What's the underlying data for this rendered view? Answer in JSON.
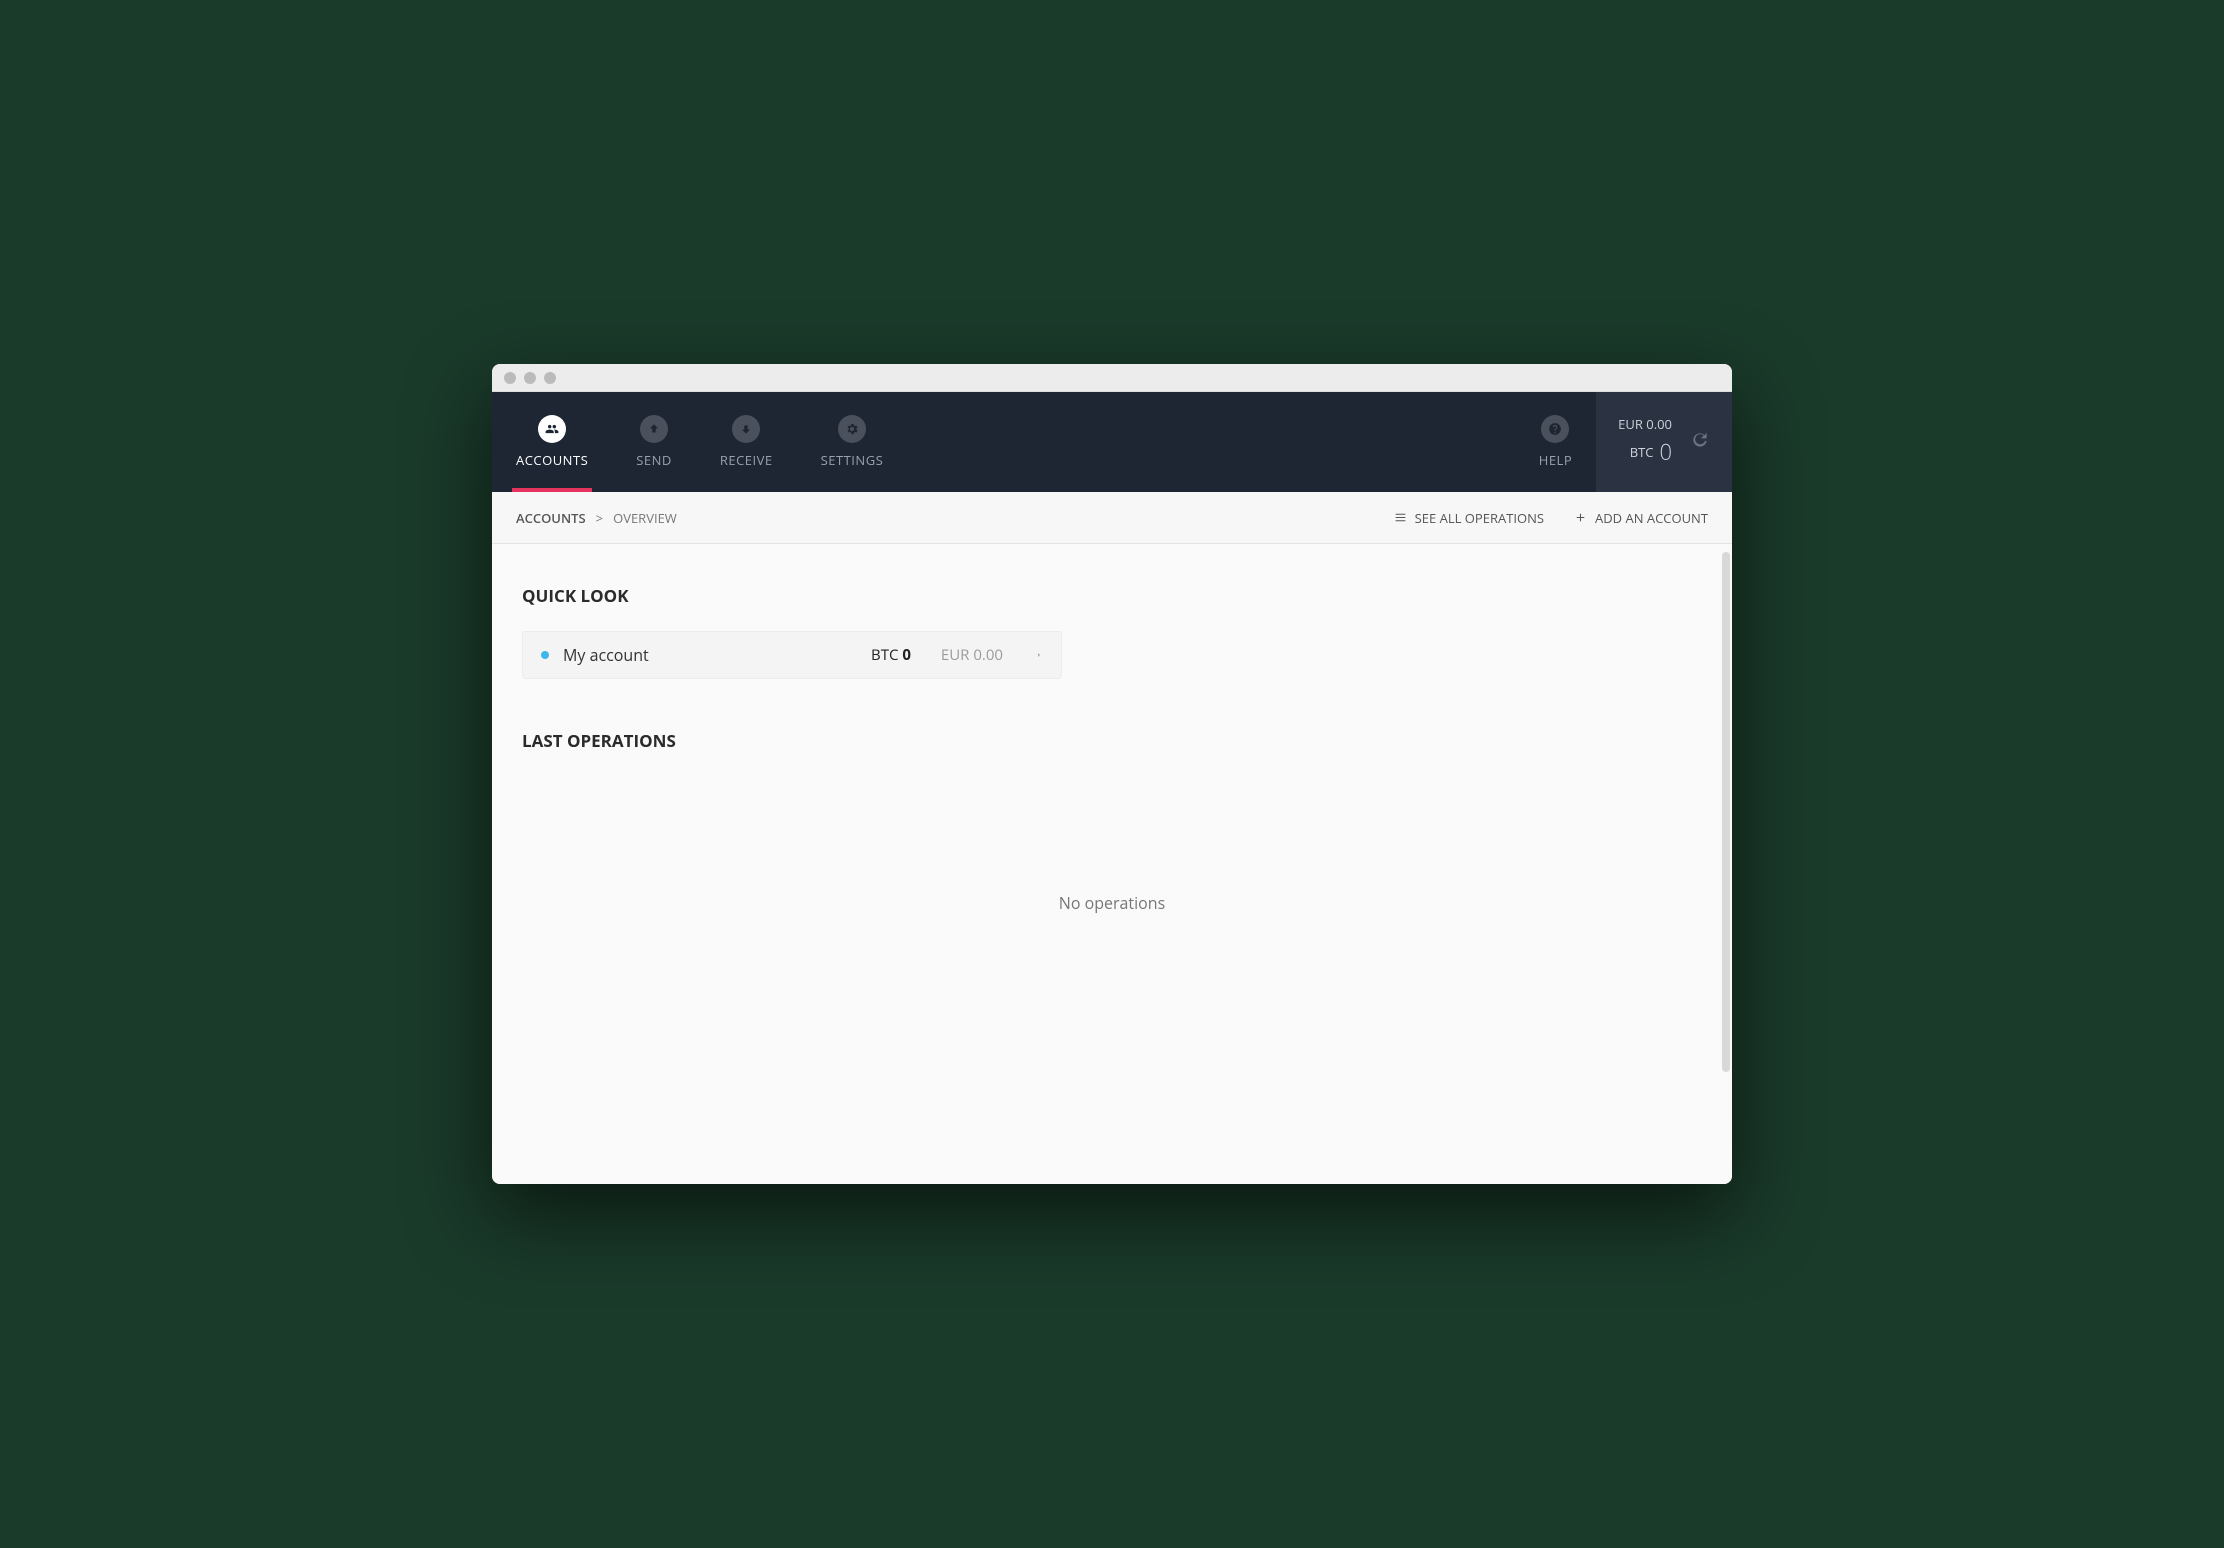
{
  "nav": {
    "items": [
      {
        "label": "ACCOUNTS",
        "icon": "accounts",
        "active": true
      },
      {
        "label": "SEND",
        "icon": "send",
        "active": false
      },
      {
        "label": "RECEIVE",
        "icon": "receive",
        "active": false
      },
      {
        "label": "SETTINGS",
        "icon": "settings",
        "active": false
      }
    ],
    "help_label": "HELP"
  },
  "balance": {
    "fiat_currency": "EUR",
    "fiat_amount": "0.00",
    "crypto_currency": "BTC",
    "crypto_amount": "0",
    "fiat_line": "EUR 0.00",
    "crypto_label": "BTC",
    "crypto_value": "0"
  },
  "breadcrumb": {
    "root": "ACCOUNTS",
    "separator": ">",
    "current": "OVERVIEW"
  },
  "actions": {
    "see_all": "SEE ALL OPERATIONS",
    "add_account": "ADD AN ACCOUNT"
  },
  "sections": {
    "quick_look": "QUICK LOOK",
    "last_ops": "LAST OPERATIONS"
  },
  "account": {
    "name": "My account",
    "btc_label": "BTC",
    "btc_value": "0",
    "eur_line": "EUR 0.00"
  },
  "empty_ops": "No operations"
}
